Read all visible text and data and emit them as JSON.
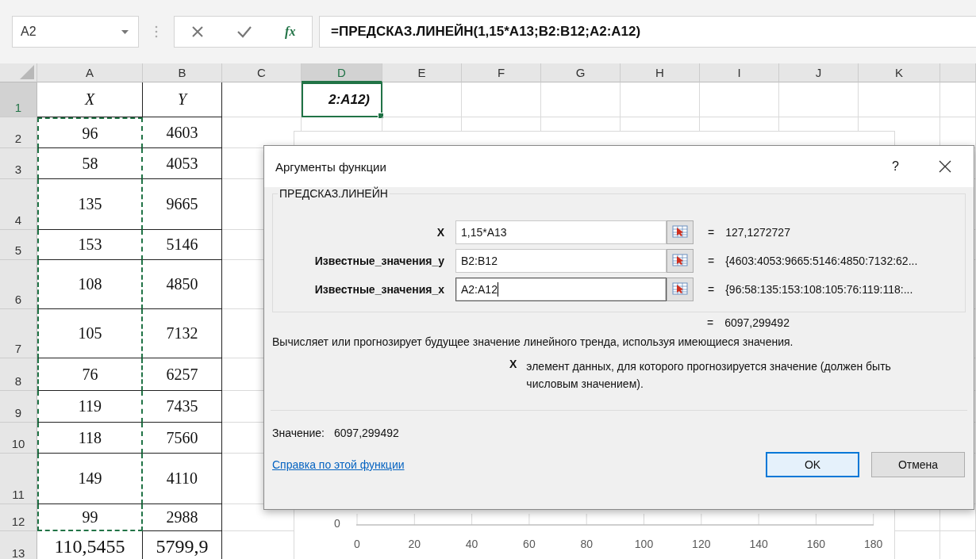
{
  "name_box": {
    "value": "A2"
  },
  "formula_bar": {
    "insert_function": "fx",
    "formula": "=ПРЕДСКАЗ.ЛИНЕЙН(1,15*A13;B2:B12;A2:A12)"
  },
  "columns": [
    {
      "label": "A",
      "selected": false
    },
    {
      "label": "B",
      "selected": false
    },
    {
      "label": "C",
      "selected": false
    },
    {
      "label": "D",
      "selected": true
    },
    {
      "label": "E",
      "selected": false
    },
    {
      "label": "F",
      "selected": false
    },
    {
      "label": "G",
      "selected": false
    },
    {
      "label": "H",
      "selected": false
    },
    {
      "label": "I",
      "selected": false
    },
    {
      "label": "J",
      "selected": false
    },
    {
      "label": "K",
      "selected": false
    }
  ],
  "rows": [
    {
      "header": "1",
      "selected": true,
      "a": "X",
      "b": "Y",
      "d": "2:A12)",
      "in_copy_range": false
    },
    {
      "header": "2",
      "selected": false,
      "a": "96",
      "b": "4603",
      "in_copy_range": true
    },
    {
      "header": "3",
      "selected": false,
      "a": "58",
      "b": "4053",
      "in_copy_range": true
    },
    {
      "header": "4",
      "selected": false,
      "a": "135",
      "b": "9665",
      "in_copy_range": true
    },
    {
      "header": "5",
      "selected": false,
      "a": "153",
      "b": "5146",
      "in_copy_range": true
    },
    {
      "header": "6",
      "selected": false,
      "a": "108",
      "b": "4850",
      "in_copy_range": true
    },
    {
      "header": "7",
      "selected": false,
      "a": "105",
      "b": "7132",
      "in_copy_range": true
    },
    {
      "header": "8",
      "selected": false,
      "a": "76",
      "b": "6257",
      "in_copy_range": true
    },
    {
      "header": "9",
      "selected": false,
      "a": "119",
      "b": "7435",
      "in_copy_range": true
    },
    {
      "header": "10",
      "selected": false,
      "a": "118",
      "b": "7560",
      "in_copy_range": true
    },
    {
      "header": "11",
      "selected": false,
      "a": "149",
      "b": "4110",
      "in_copy_range": true
    },
    {
      "header": "12",
      "selected": false,
      "a": "99",
      "b": "2988",
      "in_copy_range": true
    },
    {
      "header": "13",
      "selected": false,
      "a": "110,5455",
      "b": "5799,9",
      "in_copy_range": false
    }
  ],
  "chart": {
    "y_tick": "0",
    "x_ticks": [
      "0",
      "20",
      "40",
      "60",
      "80",
      "100",
      "120",
      "140",
      "160",
      "180"
    ]
  },
  "dialog": {
    "title": "Аргументы функции",
    "help_button": "?",
    "function_name": "ПРЕДСКАЗ.ЛИНЕЙН",
    "arguments": [
      {
        "label": "X",
        "value": "1,15*A13",
        "equals": "=",
        "result": "127,1272727",
        "focused": false
      },
      {
        "label": "Известные_значения_y",
        "value": "B2:B12",
        "equals": "=",
        "result": "{4603:4053:9665:5146:4850:7132:62...",
        "focused": false
      },
      {
        "label": "Известные_значения_x",
        "value": "A2:A12",
        "equals": "=",
        "result": "{96:58:135:153:108:105:76:119:118:...",
        "focused": true
      }
    ],
    "result_equals": "=",
    "result": "6097,299492",
    "description": "Вычисляет или прогнозирует будущее значение линейного тренда, используя имеющиеся значения.",
    "argument_help": {
      "name": "X",
      "text": "элемент данных, для которого прогнозируется значение (должен быть числовым значением)."
    },
    "value_label": "Значение:",
    "value": "6097,299492",
    "help_link": "Справка по этой функции",
    "buttons": [
      {
        "label": "OK",
        "default": true
      },
      {
        "label": "Отмена",
        "default": false
      }
    ]
  }
}
